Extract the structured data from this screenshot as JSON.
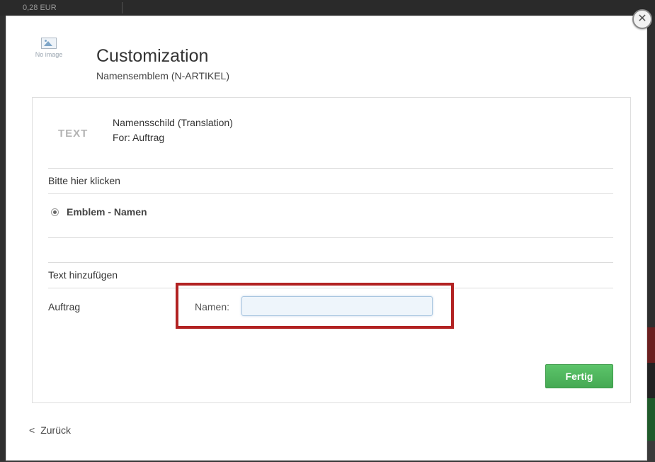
{
  "background": {
    "topbar_text": "0,28 EUR"
  },
  "dialog": {
    "no_image_text": "No image",
    "title": "Customization",
    "subtitle": "Namensemblem (N-ARTIKEL)",
    "close_icon": "close-icon",
    "item": {
      "type_label": "TEXT",
      "name": "Namensschild (Translation)",
      "for": "For: Auftrag"
    },
    "choose_section": {
      "label": "Bitte hier klicken",
      "options": [
        {
          "label": "Emblem - Namen",
          "selected": true
        }
      ]
    },
    "text_section": {
      "label": "Text hinzufügen",
      "field_label": "Auftrag",
      "input_label": "Namen:",
      "input_value": ""
    },
    "done_label": "Fertig",
    "back_label": "Zurück",
    "colors": {
      "accent_green": "#4cb65a",
      "highlight_red": "#b22222"
    }
  }
}
